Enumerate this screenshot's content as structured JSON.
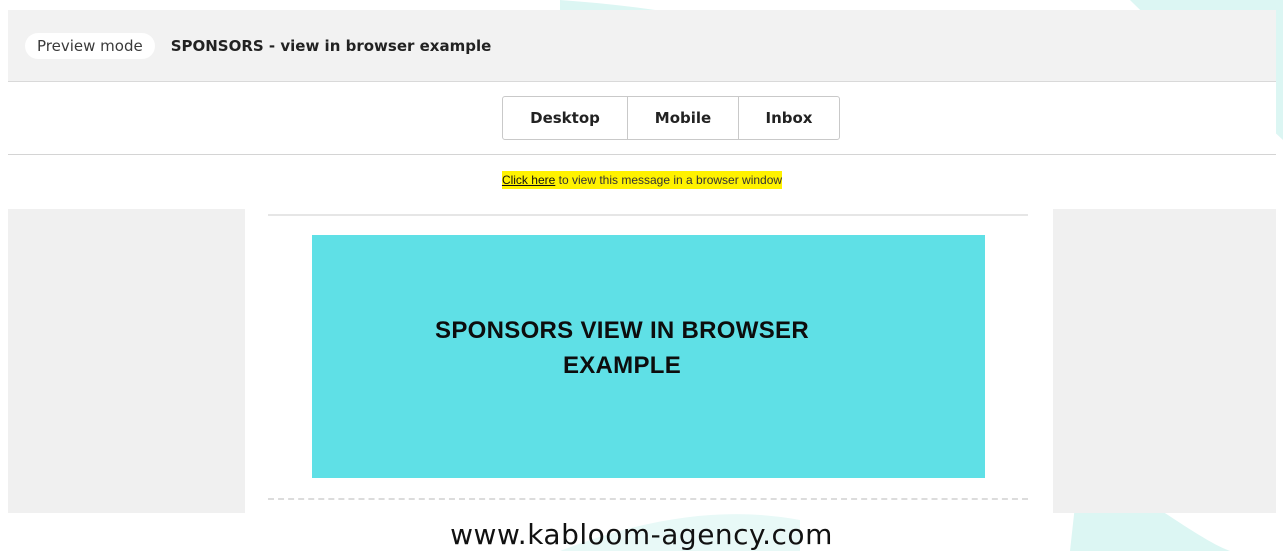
{
  "header": {
    "mode_pill": "Preview mode",
    "title": "SPONSORS - view in browser example"
  },
  "view_tabs": [
    {
      "label": "Desktop"
    },
    {
      "label": "Mobile"
    },
    {
      "label": "Inbox"
    }
  ],
  "browser_link": {
    "link_text": "Click here",
    "rest_text": " to view this message in a browser window",
    "highlight_color": "#fff200"
  },
  "email": {
    "banner_line1": "SPONSORS VIEW IN BROWSER",
    "banner_line2": "EXAMPLE",
    "banner_color": "#5fe0e6"
  },
  "watermark": "www.kabloom-agency.com",
  "colors": {
    "accent_teal": "#5fe0e6",
    "deco_teal": "#d9f5f2"
  }
}
